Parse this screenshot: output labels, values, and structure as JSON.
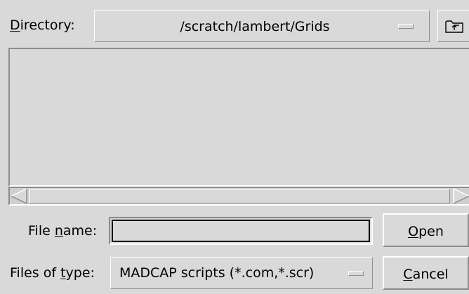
{
  "directory": {
    "label_underlined": "D",
    "label_rest": "irectory:",
    "path": "/scratch/lambert/Grids",
    "up_icon": "folder-up-icon"
  },
  "file_list": {
    "items": []
  },
  "file_name": {
    "label_pre": "File ",
    "label_underlined": "n",
    "label_post": "ame:",
    "value": ""
  },
  "files_of_type": {
    "label_pre": "Files of ",
    "label_underlined": "t",
    "label_post": "ype:",
    "selected": "MADCAP scripts (*.com,*.scr)"
  },
  "buttons": {
    "open_underlined": "O",
    "open_rest": "pen",
    "cancel_underlined": "C",
    "cancel_rest": "ancel"
  }
}
